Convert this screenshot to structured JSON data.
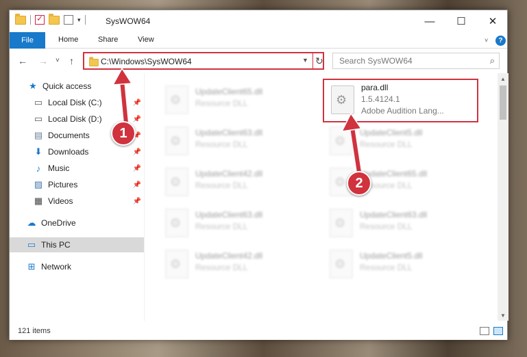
{
  "window": {
    "title": "SysWOW64"
  },
  "controls": {
    "minimize": "—",
    "maximize": "☐",
    "close": "✕"
  },
  "ribbon": {
    "file": "File",
    "home": "Home",
    "share": "Share",
    "view": "View",
    "help": "?"
  },
  "nav": {
    "back": "←",
    "forward": "→",
    "recent": "˅",
    "up": "↑",
    "refresh": "↻"
  },
  "address": {
    "path": "C:\\Windows\\SysWOW64"
  },
  "search": {
    "placeholder": "Search SysWOW64",
    "icon": "search-icon"
  },
  "sidebar": {
    "items": [
      {
        "label": "Quick access",
        "icon": "★",
        "pinned": false
      },
      {
        "label": "Local Disk (C:)",
        "icon": "▭",
        "pinned": true
      },
      {
        "label": "Local Disk (D:)",
        "icon": "▭",
        "pinned": true
      },
      {
        "label": "Documents",
        "icon": "▤",
        "pinned": true
      },
      {
        "label": "Downloads",
        "icon": "⬇",
        "pinned": true
      },
      {
        "label": "Music",
        "icon": "♪",
        "pinned": true
      },
      {
        "label": "Pictures",
        "icon": "▨",
        "pinned": true
      },
      {
        "label": "Videos",
        "icon": "▦",
        "pinned": true
      },
      {
        "label": "OneDrive",
        "icon": "☁",
        "pinned": false
      },
      {
        "label": "This PC",
        "icon": "▭",
        "pinned": false
      },
      {
        "label": "Network",
        "icon": "⊞",
        "pinned": false
      }
    ],
    "pin_glyph": "📌"
  },
  "files": {
    "highlighted": {
      "name": "para.dll",
      "version": "1.5.4124.1",
      "description": "Adobe Audition Lang..."
    },
    "left": [
      {
        "name": "UpdateClient65.dll",
        "type": "Resource DLL"
      },
      {
        "name": "UpdateClient63.dll",
        "type": "Resource DLL"
      },
      {
        "name": "UpdateClient42.dll",
        "type": "Resource DLL"
      },
      {
        "name": "UpdateClient63.dll",
        "type": "Resource DLL"
      },
      {
        "name": "UpdateClient42.dll",
        "type": "Resource DLL"
      }
    ],
    "right": [
      {
        "name": "UpdateClient5.dll",
        "type": "Resource DLL"
      },
      {
        "name": "UpdateClient65.dll",
        "type": "Resource DLL"
      },
      {
        "name": "UpdateClient63.dll",
        "type": "Resource DLL"
      },
      {
        "name": "UpdateClient5.dll",
        "type": "Resource DLL"
      }
    ]
  },
  "status": {
    "count": "121 items"
  },
  "annotations": {
    "step1": "1",
    "step2": "2"
  },
  "colors": {
    "accent": "#1979ca",
    "highlight": "#d0323e"
  }
}
